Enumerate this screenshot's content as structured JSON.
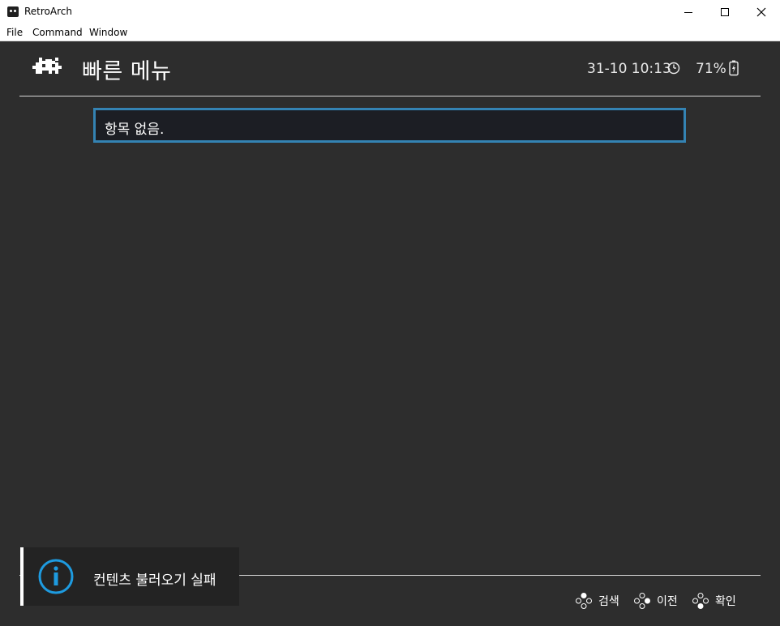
{
  "window": {
    "title": "RetroArch",
    "controls": {
      "minimize": "minimize",
      "maximize": "maximize",
      "close": "close"
    }
  },
  "menubar": {
    "items": [
      "File",
      "Command",
      "Window"
    ]
  },
  "header": {
    "title": "빠른 메뉴",
    "datetime": "31-10 10:13",
    "battery": "71%"
  },
  "content": {
    "empty_message": "항목 없음."
  },
  "notification": {
    "text": "컨텐츠 불러오기 실패",
    "icon": "info-icon"
  },
  "footer": {
    "hints": [
      {
        "label": "검색",
        "icon": "gamepad-button-icon"
      },
      {
        "label": "이전",
        "icon": "gamepad-button-icon"
      },
      {
        "label": "확인",
        "icon": "gamepad-button-icon"
      }
    ]
  },
  "colors": {
    "background": "#2d2d2d",
    "selection_border": "#3483b3",
    "selection_fill": "#1c1e24",
    "notification_icon": "#1e9be0",
    "text": "#ffffff"
  }
}
